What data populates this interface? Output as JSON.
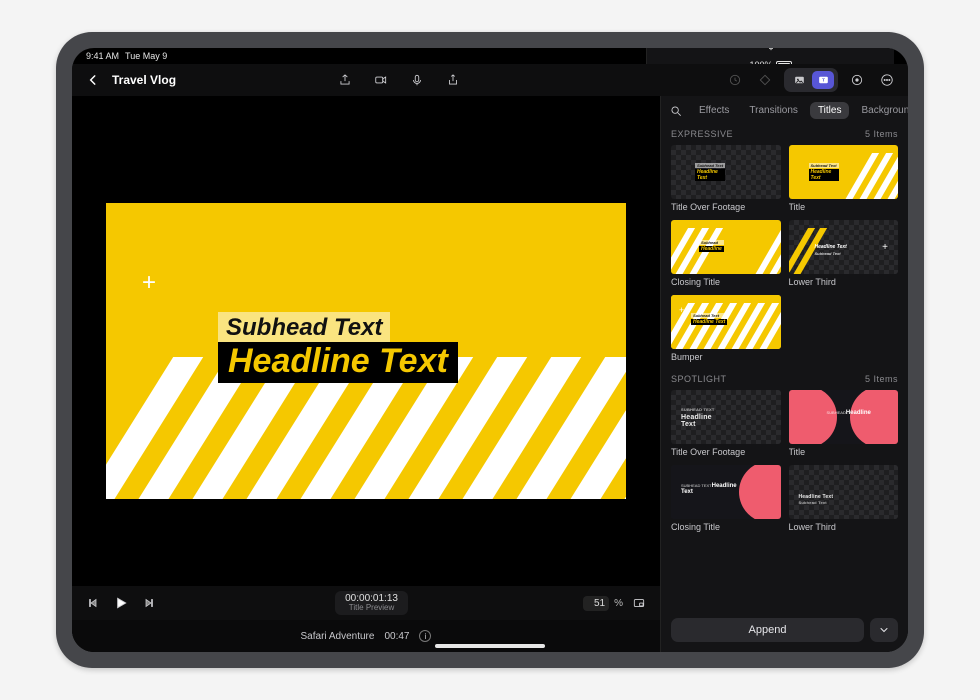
{
  "status": {
    "time": "9:41 AM",
    "date": "Tue May 9",
    "battery": "100%"
  },
  "project": {
    "title": "Travel Vlog"
  },
  "viewer": {
    "subhead": "Subhead Text",
    "headline": "Headline Text"
  },
  "transport": {
    "timecode": "00:00:01:13",
    "timecode_label": "Title Preview",
    "zoom_value": "51",
    "zoom_unit": "%"
  },
  "clip": {
    "name": "Safari Adventure",
    "duration": "00:47"
  },
  "panel": {
    "tabs": {
      "effects": "Effects",
      "transitions": "Transitions",
      "titles": "Titles",
      "backgrounds": "Backgrounds"
    },
    "sections": {
      "expressive": {
        "label": "EXPRESSIVE",
        "count": "5 Items",
        "items": [
          "Title Over Footage",
          "Title",
          "Closing Title",
          "Lower Third",
          "Bumper"
        ]
      },
      "spotlight": {
        "label": "SPOTLIGHT",
        "count": "5 Items",
        "items": [
          "Title Over Footage",
          "Title",
          "Closing Title",
          "Lower Third"
        ]
      }
    },
    "append": "Append"
  }
}
